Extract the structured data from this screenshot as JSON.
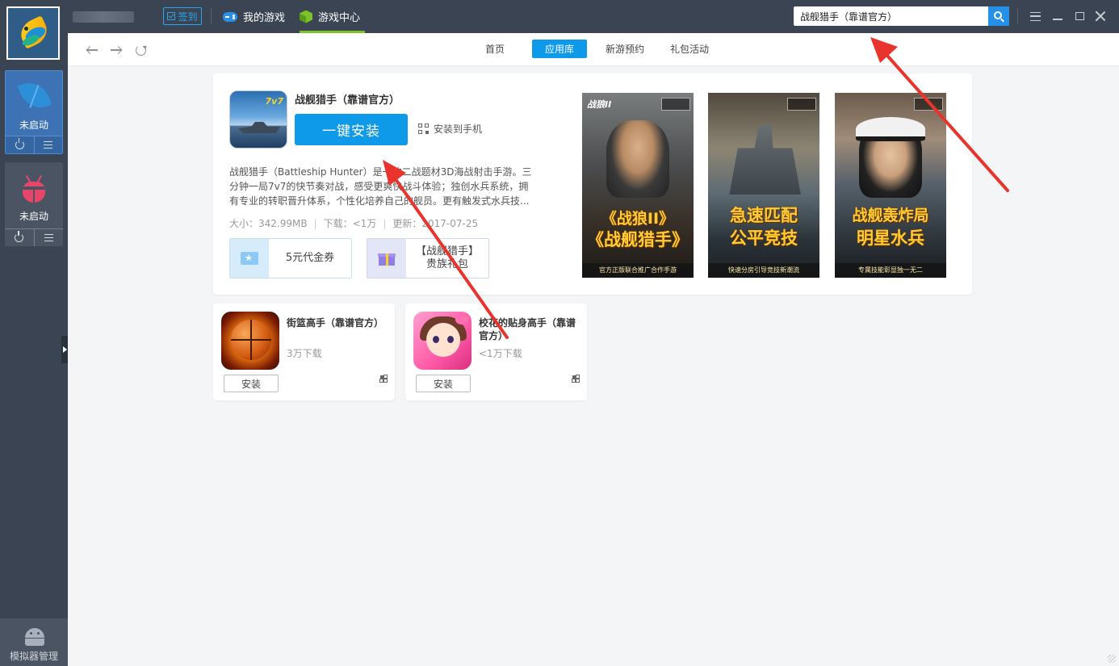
{
  "sidebar": {
    "emulators": [
      {
        "label": "未启动",
        "icon": "leaf-icon",
        "selected": true
      },
      {
        "label": "未启动",
        "icon": "bug-icon",
        "selected": false
      }
    ],
    "manager_label": "模拟器管理"
  },
  "topbar": {
    "signin_label": "签到",
    "tabs": [
      {
        "label": "我的游戏",
        "icon": "gamepad-icon",
        "active": false
      },
      {
        "label": "游戏中心",
        "icon": "cube-icon",
        "active": true
      }
    ],
    "search_value": "战舰猎手（靠谱官方）"
  },
  "nav": {
    "tabs": [
      {
        "label": "首页",
        "active": false
      },
      {
        "label": "应用库",
        "active": true
      },
      {
        "label": "新游预约",
        "active": false
      },
      {
        "label": "礼包活动",
        "active": false
      }
    ]
  },
  "featured": {
    "icon_badge": "7v7",
    "title": "战舰猎手（靠谱官方）",
    "install_label": "一键安装",
    "install_phone_label": "安装到手机",
    "description": "战舰猎手（Battleship Hunter）是一款二战题材3D海战射击手游。三分钟一局7v7的快节奏对战，感受更爽快战斗体验；独创水兵系统，拥有专业的转职晋升体系，个性化培养自己的舰员。更有触发式水兵技...",
    "meta": {
      "size": "大小：342.99MB",
      "downloads": "下载：<1万",
      "updated": "更新：2017-07-25"
    },
    "vouchers": [
      {
        "label": "5元代金券",
        "icon": "ticket-icon"
      },
      {
        "line1": "【战舰猎手】",
        "line2": "贵族礼包",
        "icon": "gift-icon"
      }
    ],
    "posters": [
      {
        "top": "战狼II",
        "caption1": "《战狼II》",
        "caption2": "《战舰猎手》",
        "footer": "官方正版联合推广合作手游"
      },
      {
        "top": "",
        "caption1": "急速匹配",
        "caption2": "公平竞技",
        "footer": "快速分房引导竞技新潮流"
      },
      {
        "top": "",
        "caption1": "战舰轰炸局",
        "caption2": "明星水兵",
        "footer": "专属技能彰显独一无二"
      }
    ]
  },
  "recommended": [
    {
      "title": "街篮高手（靠谱官方）",
      "downloads": "3万下载",
      "install_label": "安装"
    },
    {
      "title": "校花的贴身高手（靠谱官方）",
      "downloads": "<1万下载",
      "install_label": "安装"
    }
  ],
  "colors": {
    "accent": "#0e9ae8",
    "sidebar_bg": "#3a4452",
    "active_tab_underline": "#7cc32a",
    "annotation_arrow": "#e8342c"
  }
}
